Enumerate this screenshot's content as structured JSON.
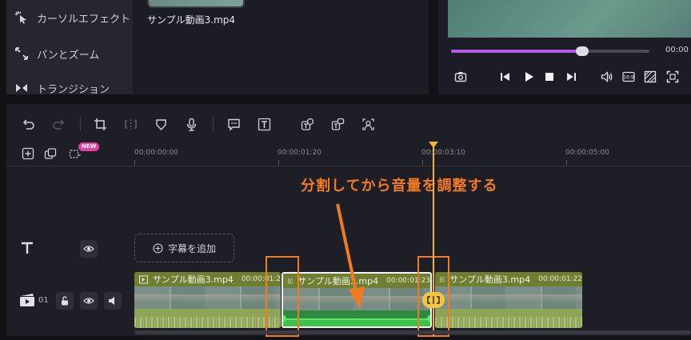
{
  "left_nav": {
    "items": [
      {
        "label": "カーソルエフェクト",
        "icon": "cursor-effect-icon"
      },
      {
        "label": "パンとズーム",
        "icon": "pan-zoom-icon"
      },
      {
        "label": "トランジション",
        "icon": "transition-icon"
      }
    ]
  },
  "media": {
    "filename": "サンプル動画3.mp4"
  },
  "preview": {
    "progress_percent": 66,
    "time": "00:00",
    "controls": [
      "snapshot-icon",
      "prev-frame-icon",
      "play-icon",
      "stop-icon",
      "next-frame-icon",
      "volume-icon",
      "aspect-ratio-icon",
      "crop-screen-icon",
      "fullscreen-icon"
    ],
    "aspect_label": "16:9"
  },
  "timeline": {
    "ruler_ticks": [
      "00:00:00:00",
      "00:00:01:20",
      "00:00:03:10",
      "00:00:05:00"
    ],
    "new_badge": "NEW",
    "annotation": "分割してから音量を調整する",
    "subtitle_track": {
      "add_label": "字幕を追加"
    },
    "video_track": {
      "number": "01",
      "clips": [
        {
          "name": "サンプル動画3.mp4",
          "duration": "00:00:01:2"
        },
        {
          "name": "サンプル動画3.mp4",
          "duration": "00:00:01:23"
        },
        {
          "name": "サンプル動画3.mp4",
          "duration": "00:00:01:22"
        }
      ]
    },
    "colors": {
      "playhead": "#f2b434",
      "annotation": "#f07b22",
      "selected_audio": "#3cc24a",
      "new_badge": "#e23fa6"
    }
  }
}
